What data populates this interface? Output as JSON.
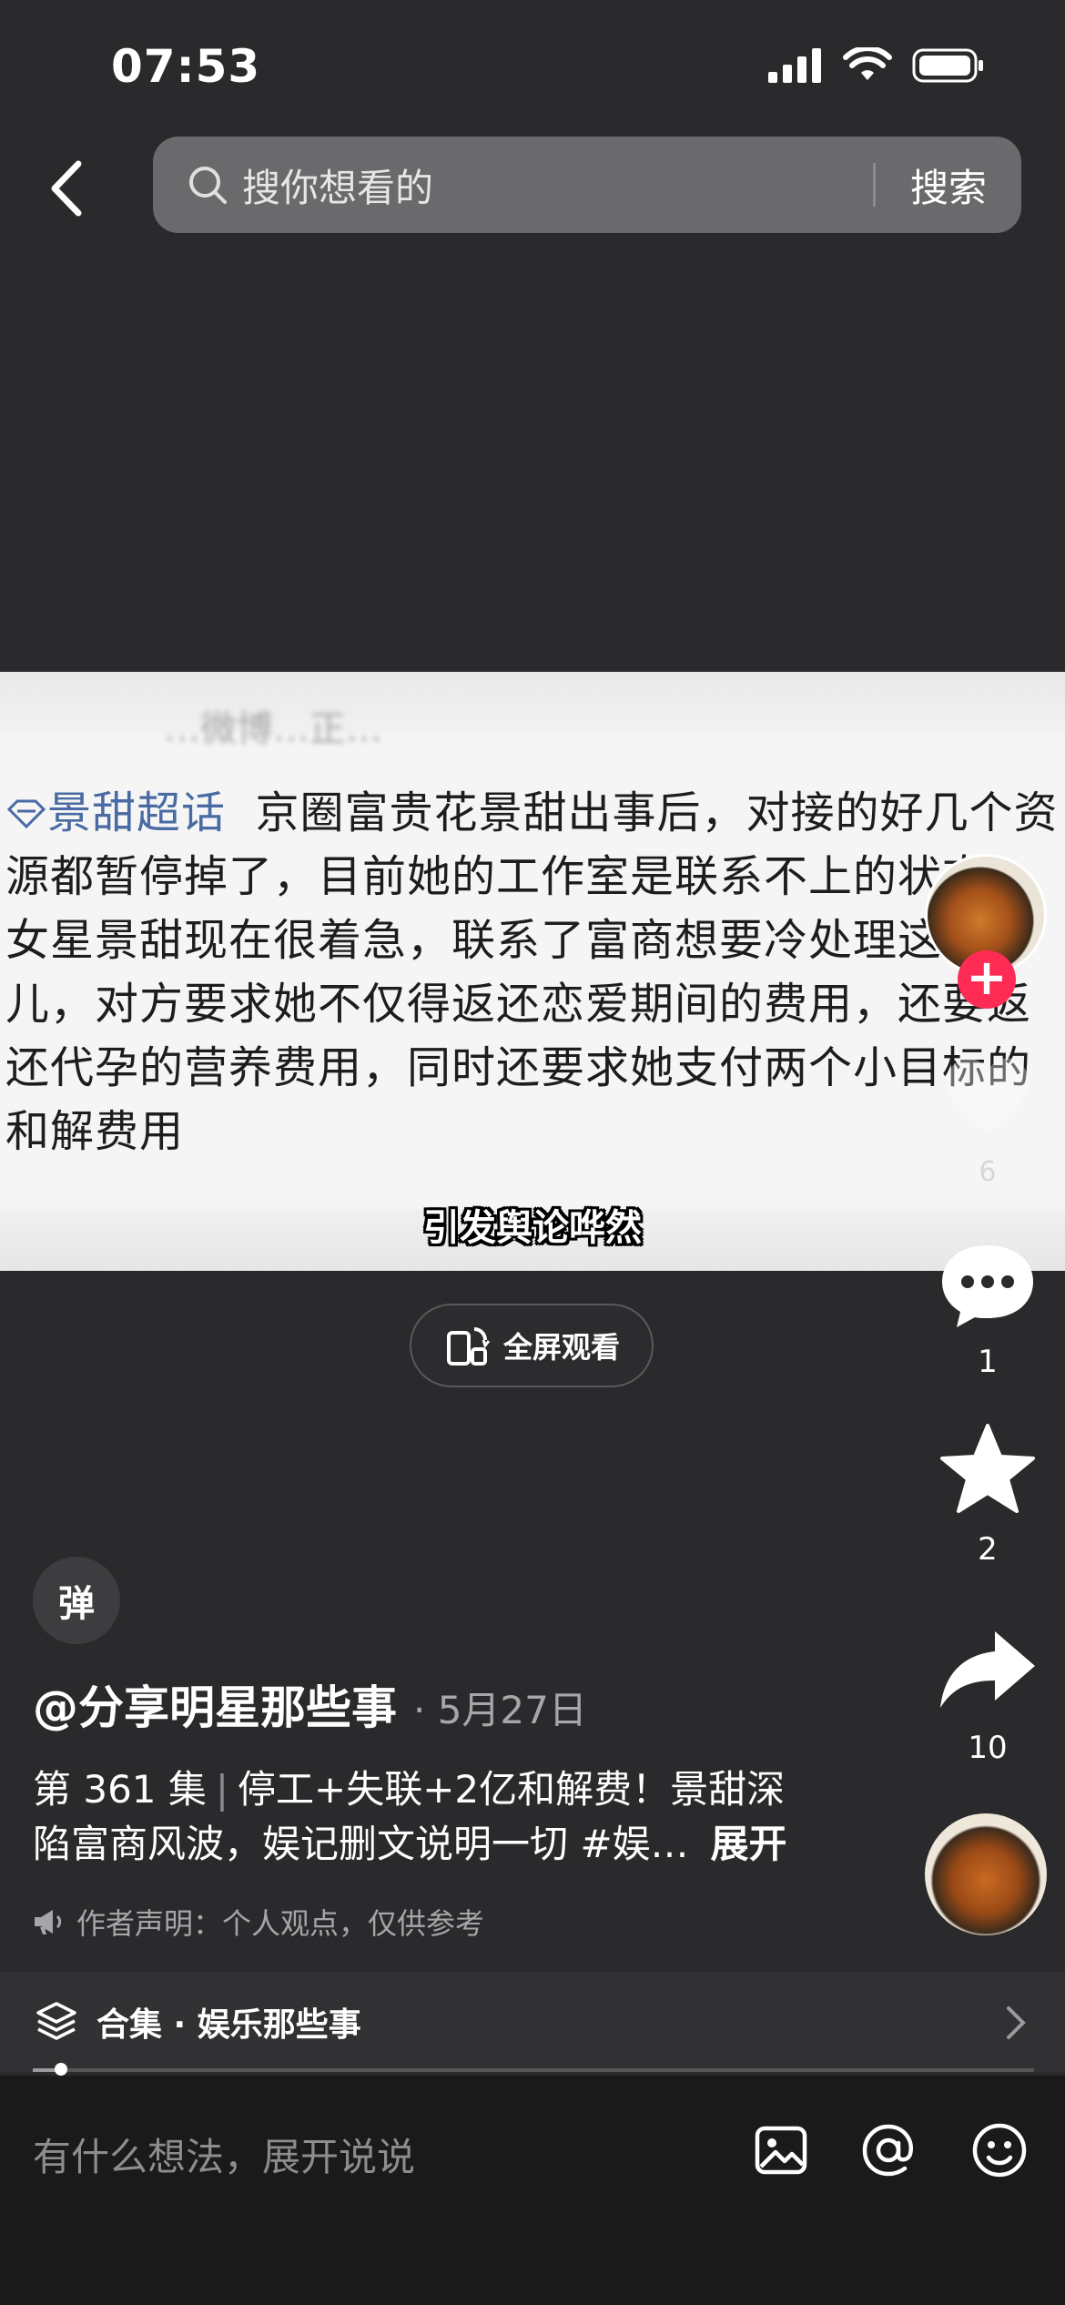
{
  "status_bar": {
    "time": "07:53"
  },
  "search": {
    "placeholder": "搜你想看的",
    "button_label": "搜索"
  },
  "video": {
    "faded_top_text": "…微博…正…",
    "topic_tag": "景甜超话",
    "post_text_1": "京圈富贵花景甜出事后，对接的好几个资源都暂停掉了，目前她的工作室是联系不上的状态。",
    "post_text_2": "女星景甜现在很着急，联系了富商想要冷处理这件事儿，对方要求她不仅得返还恋爱期间的费用，还要返还代孕的营养费用，同时还要求她支付两个小目标的和解费用",
    "subtitle": "引发舆论哗然",
    "fullscreen_label": "全屏观看"
  },
  "actions": {
    "like_count": "6",
    "comment_count": "1",
    "favorite_count": "2",
    "share_count": "10"
  },
  "danmaku_badge": "弹",
  "author": {
    "handle": "@分享明星那些事",
    "date": "· 5月27日"
  },
  "description": {
    "episode": "第 361 集",
    "text": "停工+失联+2亿和解费！景甜深陷富商风波，娱记删文说明一切 #娱…",
    "expand_label": "展开"
  },
  "disclaimer": "作者声明：个人观点，仅供参考",
  "collection": {
    "label": "合集 · 娱乐那些事"
  },
  "playback": {
    "progress_fraction": 0.025
  },
  "comment_bar": {
    "placeholder": "有什么想法，展开说说"
  },
  "icons": [
    "back-arrow-icon",
    "search-icon",
    "cellular-signal-icon",
    "wifi-icon",
    "battery-icon",
    "diamond-icon",
    "fullscreen-rotate-icon",
    "heart-icon",
    "comment-icon",
    "star-icon",
    "share-icon",
    "megaphone-icon",
    "layers-icon",
    "chevron-right-icon",
    "image-icon",
    "at-icon",
    "emoji-icon"
  ],
  "colors": {
    "accent_red": "#fe2c55",
    "topic_blue": "#4a6aa3",
    "background": "#2a2a2c"
  }
}
